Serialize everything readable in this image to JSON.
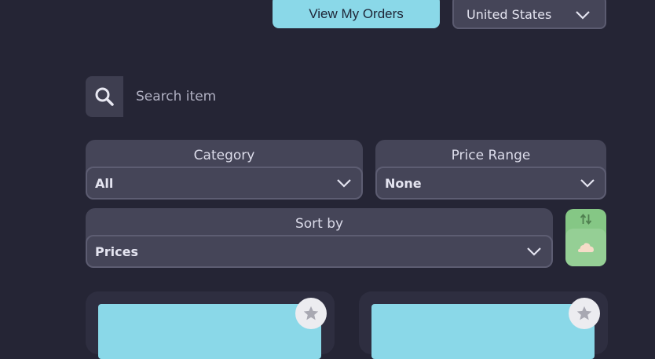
{
  "header": {
    "orders_button_label": "View My Orders",
    "country_selected": "United States"
  },
  "search": {
    "placeholder": "Search item",
    "value": ""
  },
  "filters": {
    "category": {
      "label": "Category",
      "selected": "All"
    },
    "price_range": {
      "label": "Price Range",
      "selected": "None"
    },
    "sort_by": {
      "label": "Sort by",
      "selected": "Prices"
    }
  },
  "sort_toggle": {
    "icon": "sort-arrows-icon",
    "knob_icon": "cloud-icon"
  },
  "products": [
    {
      "favorite_icon": "star-icon"
    },
    {
      "favorite_icon": "star-icon"
    }
  ],
  "colors": {
    "background": "#252535",
    "accent": "#8ad8e8",
    "panel": "#454558",
    "toggle": "#85c785"
  }
}
